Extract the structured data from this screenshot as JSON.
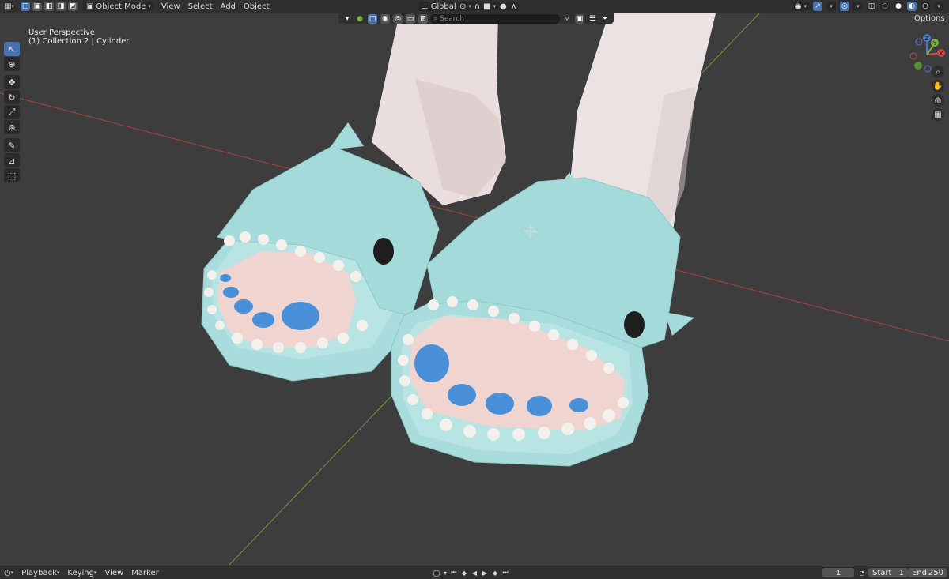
{
  "header": {
    "mode": "Object Mode",
    "menus": [
      "View",
      "Select",
      "Add",
      "Object"
    ],
    "transform_orientation": "Global",
    "search_placeholder": "Search",
    "options": "Options"
  },
  "viewport": {
    "perspective": "User Perspective",
    "collection": "(1) Collection 2 | Cylinder"
  },
  "tools": [
    "select-box",
    "cursor",
    "move",
    "rotate",
    "scale",
    "transform",
    "annotate",
    "measure",
    "add-cube"
  ],
  "gizmo": {
    "x": "X",
    "y": "Y",
    "z": "Z"
  },
  "timeline": {
    "menus": [
      "Playback",
      "Keying",
      "View",
      "Marker"
    ],
    "current_frame": "1",
    "start_label": "Start",
    "start": "1",
    "end_label": "End",
    "end": "250"
  },
  "colors": {
    "accent": "#4772b3",
    "slipper": "#a9dcdc",
    "nail": "#4a90d8",
    "x_axis": "#b04040",
    "y_axis": "#6a9a3a"
  }
}
